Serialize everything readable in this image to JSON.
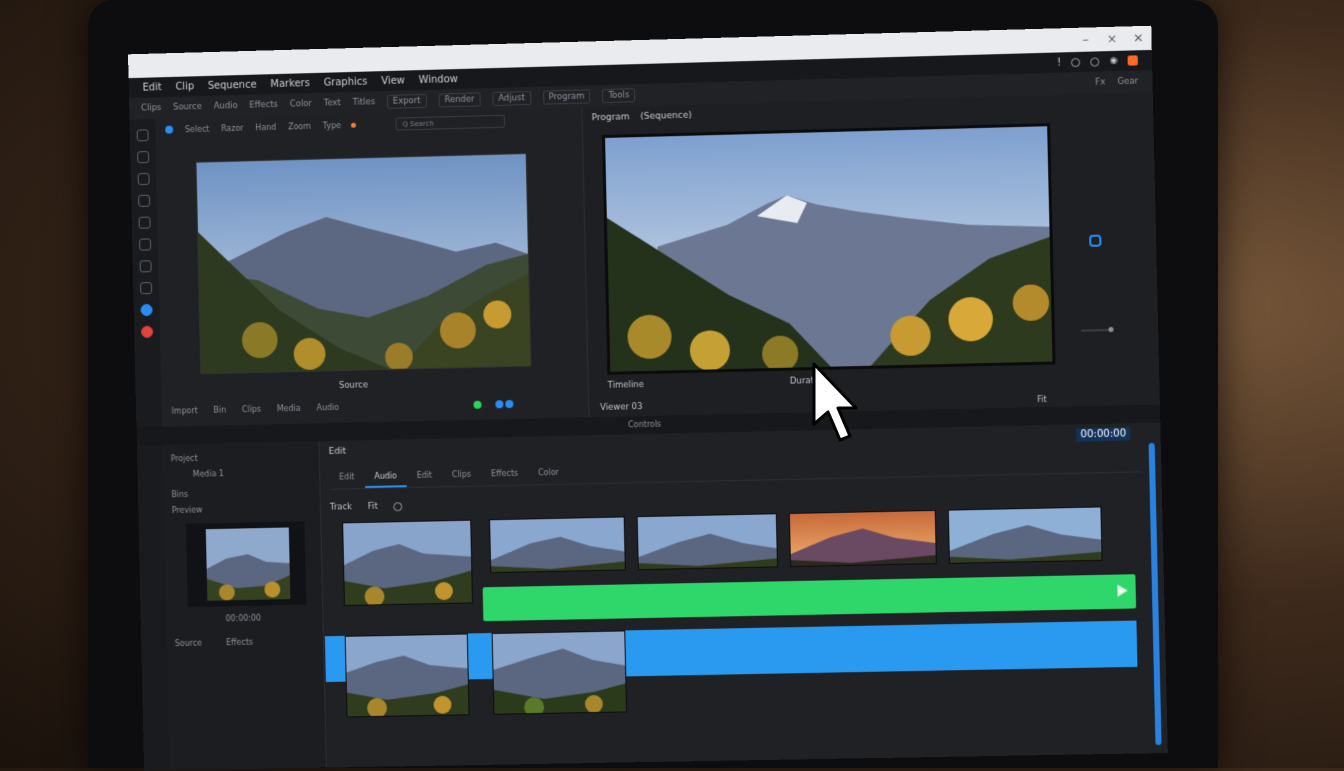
{
  "window": {
    "title": "",
    "controls": [
      "–",
      "×",
      "✕"
    ]
  },
  "menubar": {
    "items": [
      "Edit",
      "Clip",
      "Sequence",
      "Markers",
      "Graphics",
      "View",
      "Window"
    ],
    "right_icons": [
      "alert-icon",
      "settings-icon",
      "share-icon",
      "lock-icon",
      "orange-square-icon"
    ]
  },
  "toolbar": {
    "items": [
      "Clips",
      "Source",
      "Audio",
      "Effects",
      "Color",
      "Text",
      "Titles",
      "Export",
      "Render",
      "Adjust",
      "Program",
      "Tools"
    ],
    "right": [
      "Fx",
      "Gear"
    ]
  },
  "source": {
    "toolbar": [
      "Select",
      "Razor",
      "Hand",
      "Zoom",
      "Type"
    ],
    "search_placeholder": "Q  Search",
    "label": "Source",
    "footer": [
      "Import",
      "Bin",
      "Clips",
      "Media",
      "Audio"
    ]
  },
  "program": {
    "header": "Program",
    "header_badge": "(Sequence)",
    "label_left": "Timeline",
    "label_center": "Duration",
    "footer": "Viewer  03",
    "fit": "Fit"
  },
  "divider": {
    "label": "Controls"
  },
  "lower_left": {
    "rows": [
      "Project",
      "Media 1",
      "Bins",
      "Preview",
      "Source",
      "Effects"
    ],
    "thumb_caption": "00:00:00"
  },
  "timeline": {
    "header": "Edit",
    "timecode": "00:00:00",
    "tabs": [
      "Edit",
      "Audio",
      "Edit",
      "Clips",
      "Effects",
      "Color"
    ],
    "active_tab_index": 1,
    "sub": [
      "Track",
      "Fit"
    ]
  },
  "colors": {
    "accent": "#2a8df5",
    "green_track": "#2fd66a",
    "blue_track": "#2a9af0",
    "record": "#ff6a2b"
  }
}
